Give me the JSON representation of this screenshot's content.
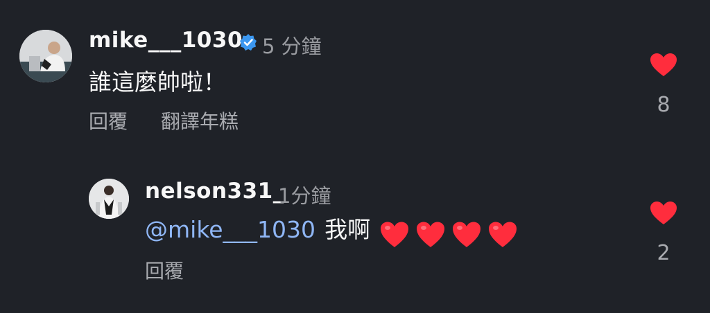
{
  "colors": {
    "background": "#1f2228",
    "heart_red": "#ff2d3d",
    "mention_blue": "#8fb6f5",
    "verified_blue": "#3b97f0",
    "secondary_text": "#9a9ca1"
  },
  "comments": [
    {
      "username": "mike___1030",
      "verified": true,
      "time": "5 分鐘",
      "text": "誰這麼帥啦！",
      "actions": [
        "回覆",
        "翻譯年糕"
      ],
      "like_count": "8",
      "liked": true
    },
    {
      "username": "nelson331_",
      "verified": false,
      "time": "1分鐘",
      "mention": "@mike___1030",
      "text": "我啊",
      "heart_emoji_count": 4,
      "actions": [
        "回覆"
      ],
      "like_count": "2",
      "liked": true
    }
  ]
}
